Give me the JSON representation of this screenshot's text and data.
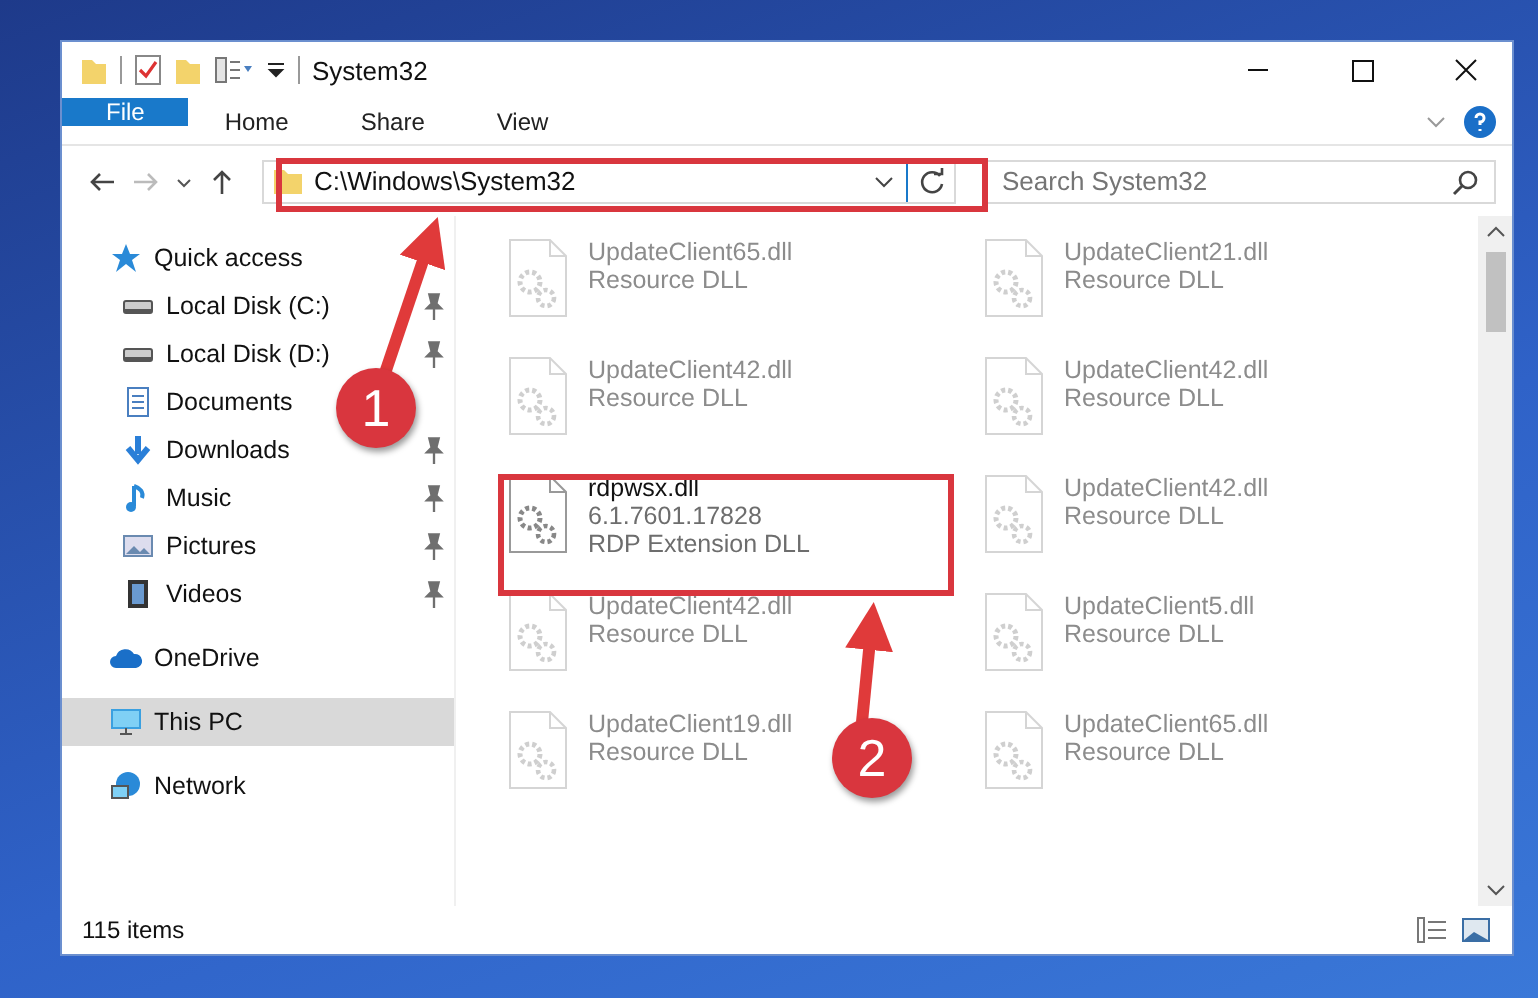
{
  "window": {
    "title": "System32"
  },
  "ribbon_tabs": [
    {
      "label": "File",
      "kind": "file"
    },
    {
      "label": "Home",
      "kind": "tab"
    },
    {
      "label": "Share",
      "kind": "tab"
    },
    {
      "label": "View",
      "kind": "tab"
    }
  ],
  "address": {
    "path": "C:\\Windows\\System32"
  },
  "search": {
    "placeholder": "Search System32"
  },
  "nav": [
    {
      "label": "Quick access",
      "selected": false,
      "children": [
        {
          "label": "Local Disk (C:)",
          "pinned": true,
          "selected": false
        },
        {
          "label": "Local Disk (D:)",
          "pinned": true,
          "selected": false
        },
        {
          "label": "Documents",
          "pinned": false,
          "selected": false
        },
        {
          "label": "Downloads",
          "pinned": true,
          "selected": false
        },
        {
          "label": "Music",
          "pinned": true,
          "selected": false
        },
        {
          "label": "Pictures",
          "pinned": true,
          "selected": false
        },
        {
          "label": "Videos",
          "pinned": true,
          "selected": false
        }
      ]
    },
    {
      "label": "OneDrive",
      "selected": false
    },
    {
      "label": "This PC",
      "selected": true
    },
    {
      "label": "Network",
      "selected": false
    }
  ],
  "files": [
    {
      "lines": [
        "UpdateClient65.dll",
        "Resource DLL"
      ],
      "dimmed": true
    },
    {
      "lines": [
        "UpdateClient21.dll",
        "Resource DLL"
      ],
      "dimmed": true
    },
    {
      "lines": [
        "UpdateClient42.dll",
        "Resource DLL"
      ],
      "dimmed": true
    },
    {
      "lines": [
        "UpdateClient42.dll",
        "Resource DLL"
      ],
      "dimmed": true
    },
    {
      "lines": [
        "rdpwsx.dll",
        "6.1.7601.17828",
        "RDP Extension DLL"
      ],
      "dimmed": false
    },
    {
      "lines": [
        "UpdateClient42.dll",
        "Resource DLL"
      ],
      "dimmed": true
    },
    {
      "lines": [
        "UpdateClient42.dll",
        "Resource DLL"
      ],
      "dimmed": true
    },
    {
      "lines": [
        "UpdateClient5.dll",
        "Resource DLL"
      ],
      "dimmed": true
    },
    {
      "lines": [
        "UpdateClient19.dll",
        "Resource DLL"
      ],
      "dimmed": true
    },
    {
      "lines": [
        "UpdateClient65.dll",
        "Resource DLL"
      ],
      "dimmed": true
    }
  ],
  "status_bar": {
    "count": "115 items"
  },
  "annotations": [
    {
      "number": "1"
    },
    {
      "number": "2"
    }
  ]
}
